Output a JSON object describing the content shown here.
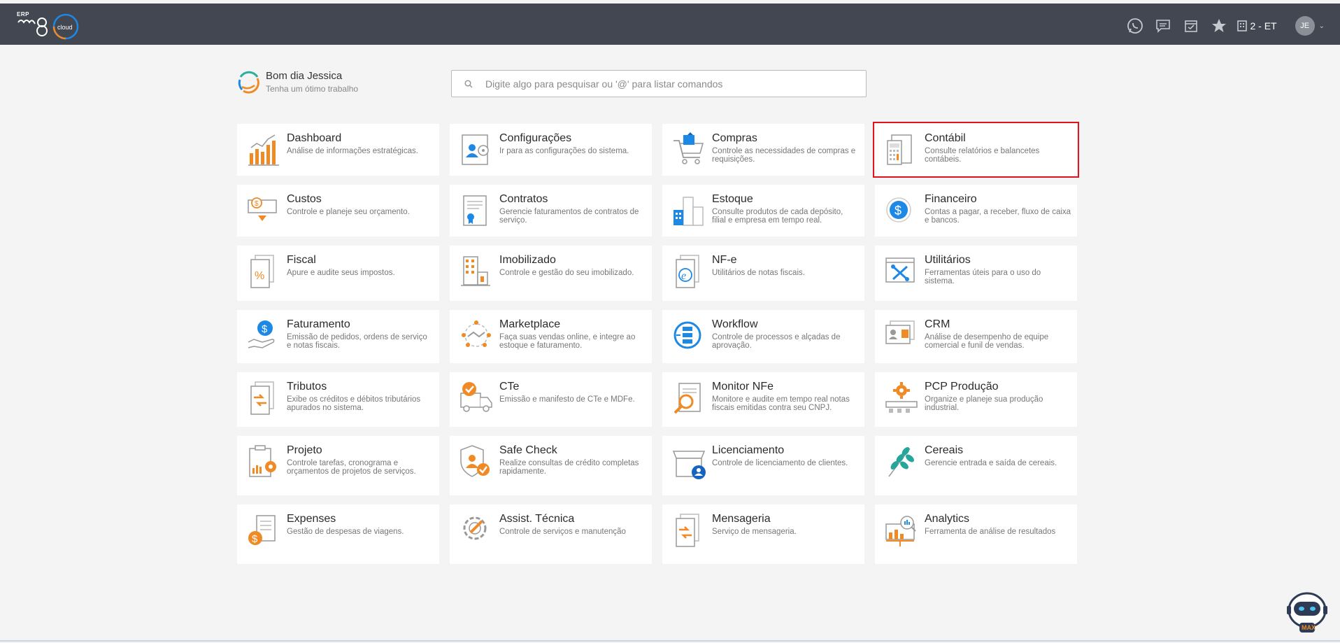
{
  "header": {
    "logo_small": "ERP",
    "logo_tag": "cloud",
    "company": "2 - ET",
    "user_initials": "JE",
    "icons": [
      "whatsapp-icon",
      "chat-icon",
      "calendar-icon",
      "star-icon",
      "building-icon"
    ],
    "bg": "#424752"
  },
  "greeting": {
    "title": "Bom dia Jessica",
    "subtitle": "Tenha um ótimo trabalho"
  },
  "search": {
    "placeholder": "Digite algo para pesquisar ou '@' para listar comandos"
  },
  "modules": [
    {
      "title": "Dashboard",
      "desc": "Análise de informações estratégicas."
    },
    {
      "title": "Configurações",
      "desc": "Ir para as configurações do sistema."
    },
    {
      "title": "Compras",
      "desc": "Controle as necessidades de compras e requisições."
    },
    {
      "title": "Contábil",
      "desc": "Consulte relatórios e balancetes contábeis."
    },
    {
      "title": "Custos",
      "desc": "Controle e planeje seu orçamento."
    },
    {
      "title": "Contratos",
      "desc": "Gerencie faturamentos de contratos de serviço."
    },
    {
      "title": "Estoque",
      "desc": "Consulte produtos de cada depósito, filial e empresa em tempo real."
    },
    {
      "title": "Financeiro",
      "desc": "Contas a pagar, a receber, fluxo de caixa e bancos."
    },
    {
      "title": "Fiscal",
      "desc": "Apure e audite seus impostos."
    },
    {
      "title": "Imobilizado",
      "desc": "Controle e gestão do seu imobilizado."
    },
    {
      "title": "NF-e",
      "desc": "Utilitários de notas fiscais."
    },
    {
      "title": "Utilitários",
      "desc": "Ferramentas úteis para o uso do sistema."
    },
    {
      "title": "Faturamento",
      "desc": "Emissão de pedidos, ordens de serviço e notas fiscais."
    },
    {
      "title": "Marketplace",
      "desc": "Faça suas vendas online, e integre ao estoque e faturamento."
    },
    {
      "title": "Workflow",
      "desc": "Controle de processos e alçadas de aprovação."
    },
    {
      "title": "CRM",
      "desc": "Análise de desempenho de equipe comercial e funil de vendas."
    },
    {
      "title": "Tributos",
      "desc": "Exibe os créditos e débitos tributários apurados no sistema."
    },
    {
      "title": "CTe",
      "desc": "Emissão e manifesto de CTe e MDFe."
    },
    {
      "title": "Monitor NFe",
      "desc": "Monitore e audite em tempo real notas fiscais emitidas contra seu CNPJ."
    },
    {
      "title": "PCP Produção",
      "desc": "Organize e planeje sua produção industrial."
    },
    {
      "title": "Projeto",
      "desc": "Controle tarefas, cronograma e orçamentos de projetos de serviços."
    },
    {
      "title": "Safe Check",
      "desc": "Realize consultas de crédito completas rapidamente."
    },
    {
      "title": "Licenciamento",
      "desc": "Controle de licenciamento de clientes."
    },
    {
      "title": "Cereais",
      "desc": "Gerencie entrada e saída de cereais."
    },
    {
      "title": "Expenses",
      "desc": "Gestão de despesas de viagens."
    },
    {
      "title": "Assist. Técnica",
      "desc": "Controle de serviços e manutenção"
    },
    {
      "title": "Mensageria",
      "desc": "Serviço de mensageria."
    },
    {
      "title": "Analytics",
      "desc": "Ferramenta de análise de resultados"
    }
  ],
  "highlighted_module": "Contábil",
  "assistant": {
    "label": "MAX"
  },
  "colors": {
    "accent": "#f08a24",
    "blue": "#1e88e5",
    "highlight": "#e0141e"
  }
}
